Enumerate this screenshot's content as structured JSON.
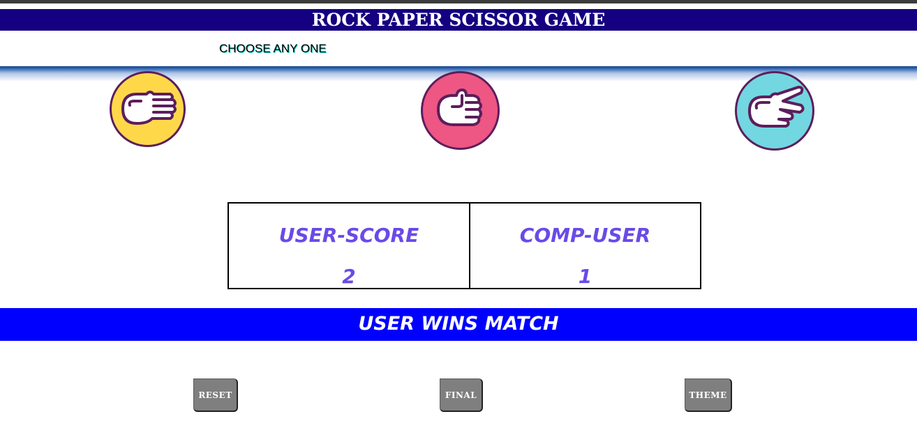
{
  "header": {
    "title": "ROCK PAPER SCISSOR GAME",
    "instruction": "CHOOSE ANY ONE"
  },
  "choices": [
    {
      "name": "paper",
      "icon": "paper-hand-icon",
      "color": "#ffd84a"
    },
    {
      "name": "rock",
      "icon": "rock-fist-icon",
      "color": "#ee5683"
    },
    {
      "name": "scissor",
      "icon": "scissor-hand-icon",
      "color": "#72d7e0"
    }
  ],
  "scoreboard": {
    "user_label": "USER-SCORE",
    "user_score": "2",
    "comp_label": "COMP-USER",
    "comp_score": "1",
    "text_color": "#6a4ae8"
  },
  "result": {
    "message": "USER WINS MATCH",
    "background": "#0000ff"
  },
  "buttons": {
    "reset": "RESET",
    "final": "FINAL",
    "theme": "THEME"
  },
  "colors": {
    "title_bar": "#140080",
    "top_strip": "#3c3c3c",
    "icon_border": "#5c1e5c",
    "button_bg": "#7f7f7f"
  }
}
